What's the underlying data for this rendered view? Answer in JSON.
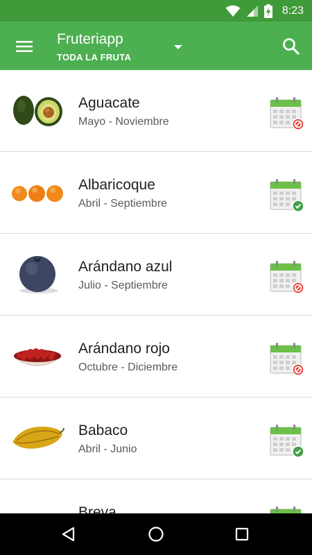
{
  "status_bar": {
    "time": "8:23",
    "icons": [
      "wifi-icon",
      "signal-icon",
      "battery-charging-icon"
    ]
  },
  "app_bar": {
    "title": "Fruteriapp",
    "subtitle": "TODA LA FRUTA",
    "menu_icon": "menu-icon",
    "dropdown_icon": "dropdown-icon",
    "search_icon": "search-icon"
  },
  "fruits": [
    {
      "name": "Aguacate",
      "season": "Mayo - Noviembre",
      "in_season": false,
      "thumb": "avocado"
    },
    {
      "name": "Albaricoque",
      "season": "Abril - Septiembre",
      "in_season": true,
      "thumb": "apricot"
    },
    {
      "name": "Arándano azul",
      "season": "Julio - Septiembre",
      "in_season": false,
      "thumb": "blueberry"
    },
    {
      "name": "Arándano rojo",
      "season": "Octubre - Diciembre",
      "in_season": false,
      "thumb": "cranberry"
    },
    {
      "name": "Babaco",
      "season": "Abril - Junio",
      "in_season": true,
      "thumb": "babaco"
    },
    {
      "name": "Breva",
      "season": "",
      "in_season": true,
      "thumb": "breva"
    }
  ],
  "nav_bar": {
    "buttons": [
      "back-icon",
      "home-icon",
      "recents-icon"
    ]
  },
  "colors": {
    "status": "#3f9a3a",
    "primary": "#4caf50",
    "ok": "#43a047",
    "no": "#e53935"
  }
}
